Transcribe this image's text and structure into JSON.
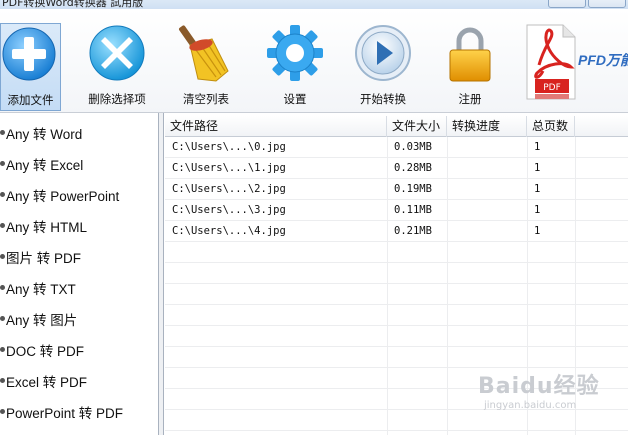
{
  "window": {
    "title": "PDF转换Word转换器 試用版"
  },
  "toolbar": {
    "buttons": [
      {
        "label": "添加文件",
        "icon": "add-icon"
      },
      {
        "label": "删除选择项",
        "icon": "delete-icon"
      },
      {
        "label": "清空列表",
        "icon": "broom-icon"
      },
      {
        "label": "设置",
        "icon": "gear-icon"
      },
      {
        "label": "开始转换",
        "icon": "play-icon"
      },
      {
        "label": "注册",
        "icon": "lock-icon"
      }
    ],
    "brand_text": "PFD万能",
    "pdf_badge": "PDF"
  },
  "sidebar": {
    "items": [
      {
        "label": "Any 转 Word"
      },
      {
        "label": "Any 转 Excel"
      },
      {
        "label": "Any 转 PowerPoint"
      },
      {
        "label": "Any 转 HTML"
      },
      {
        "label": "图片 转 PDF"
      },
      {
        "label": "Any 转 TXT"
      },
      {
        "label": "Any 转 图片"
      },
      {
        "label": "DOC 转 PDF"
      },
      {
        "label": "Excel 转 PDF"
      },
      {
        "label": "PowerPoint 转 PDF"
      }
    ]
  },
  "table": {
    "headers": [
      "文件路径",
      "文件大小",
      "转换进度",
      "总页数"
    ],
    "rows": [
      {
        "path": "C:\\Users\\...\\0.jpg",
        "size": "0.03MB",
        "progress": "",
        "pages": "1"
      },
      {
        "path": "C:\\Users\\...\\1.jpg",
        "size": "0.28MB",
        "progress": "",
        "pages": "1"
      },
      {
        "path": "C:\\Users\\...\\2.jpg",
        "size": "0.19MB",
        "progress": "",
        "pages": "1"
      },
      {
        "path": "C:\\Users\\...\\3.jpg",
        "size": "0.11MB",
        "progress": "",
        "pages": "1"
      },
      {
        "path": "C:\\Users\\...\\4.jpg",
        "size": "0.21MB",
        "progress": "",
        "pages": "1"
      }
    ]
  },
  "watermark": {
    "main": "Baidu经验",
    "sub": "jingyan.baidu.com"
  },
  "colors": {
    "accent_blue": "#2f8fe0",
    "delete_blue": "#27a8e8",
    "gear_blue": "#2e9ee8",
    "pdf_red": "#d8231f",
    "lock_gold": "#f0a400"
  }
}
